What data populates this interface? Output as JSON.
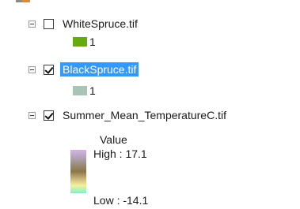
{
  "toc": {
    "layers": [
      {
        "name": "WhiteSpruce.tif",
        "checked": false,
        "selected": false,
        "legend": [
          {
            "label": "1",
            "color": "#66aa11"
          }
        ]
      },
      {
        "name": "BlackSpruce.tif",
        "checked": true,
        "selected": true,
        "legend": [
          {
            "label": "1",
            "color": "#a7c4b5"
          }
        ]
      },
      {
        "name": "Summer_Mean_TemperatureC.tif",
        "checked": true,
        "selected": false,
        "ramp": {
          "title": "Value",
          "high_label": "High : 17.1",
          "low_label": "Low : -14.1"
        }
      }
    ]
  },
  "colors": {
    "selection": "#3399ff",
    "white_spruce_swatch": "#66aa11",
    "black_spruce_swatch": "#a7c4b5"
  }
}
